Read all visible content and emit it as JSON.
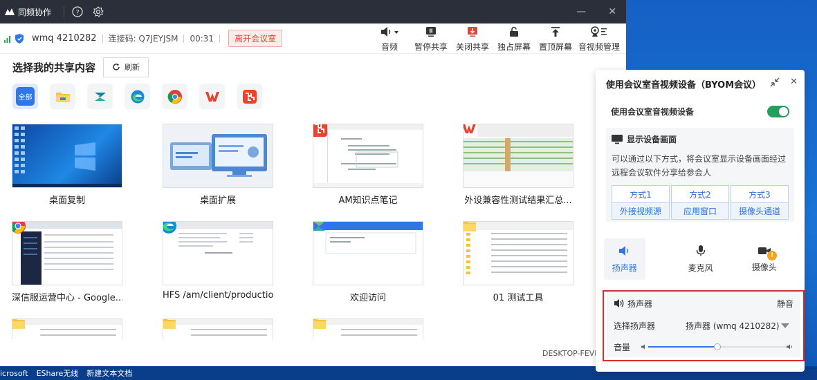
{
  "app": {
    "title": "同频协作"
  },
  "taskbar": {
    "items": [
      "icrosoft",
      "EShare无线",
      "新建文本文档"
    ]
  },
  "toolbar": {
    "user": "wmq 4210282",
    "code_label": "连接码: Q7JEYJSM",
    "timer": "00:31",
    "leave_label": "离开会议室",
    "buttons": [
      {
        "label": "音频",
        "icon": "speaker-icon"
      },
      {
        "label": "暂停共享",
        "icon": "pause-share-icon"
      },
      {
        "label": "关闭共享",
        "icon": "stop-share-icon"
      },
      {
        "label": "独占屏幕",
        "icon": "lock-icon"
      },
      {
        "label": "置顶屏幕",
        "icon": "pin-top-icon"
      },
      {
        "label": "音视频管理",
        "icon": "av-manage-icon"
      }
    ]
  },
  "share": {
    "heading": "选择我的共享内容",
    "refresh_label": "刷新",
    "filter_all": "全部",
    "items": [
      {
        "label": "桌面复制",
        "badge": ""
      },
      {
        "label": "桌面扩展",
        "badge": ""
      },
      {
        "label": "AM知识点笔记",
        "badge": "xmind-icon"
      },
      {
        "label": "外设兼容性测试结果汇总...",
        "badge": "wps-icon"
      },
      {
        "label": "深信服运营中心 - Google...",
        "badge": "chrome-icon"
      },
      {
        "label": "HFS /am/client/productio...",
        "badge": "edge-icon"
      },
      {
        "label": "欢迎访问",
        "badge": ""
      },
      {
        "label": "01 测试工具",
        "badge": ""
      }
    ],
    "hostname": "DESKTOP-FEVE"
  },
  "panel": {
    "title": "使用会议室音视频设备（BYOM会议）",
    "use_device_label": "使用会议室音视频设备",
    "use_device_on": true,
    "display_title": "显示设备画面",
    "display_desc": "可以通过以下方式，将会议室显示设备画面经过远程会议软件分享给参会人",
    "methods": [
      {
        "name": "方式1",
        "detail": "外接视频源"
      },
      {
        "name": "方式2",
        "detail": "应用窗口"
      },
      {
        "name": "方式3",
        "detail": "摄像头通道"
      }
    ],
    "tabs": [
      {
        "label": "扬声器",
        "active": true
      },
      {
        "label": "麦克风",
        "active": false
      },
      {
        "label": "摄像头",
        "active": false,
        "warning": "!"
      }
    ],
    "speaker": {
      "title": "扬声器",
      "mute_label": "静音",
      "select_label": "选择扬声器",
      "selected": "扬声器 (wmq 4210282)",
      "volume_label": "音量",
      "volume_level": 0.5
    }
  }
}
